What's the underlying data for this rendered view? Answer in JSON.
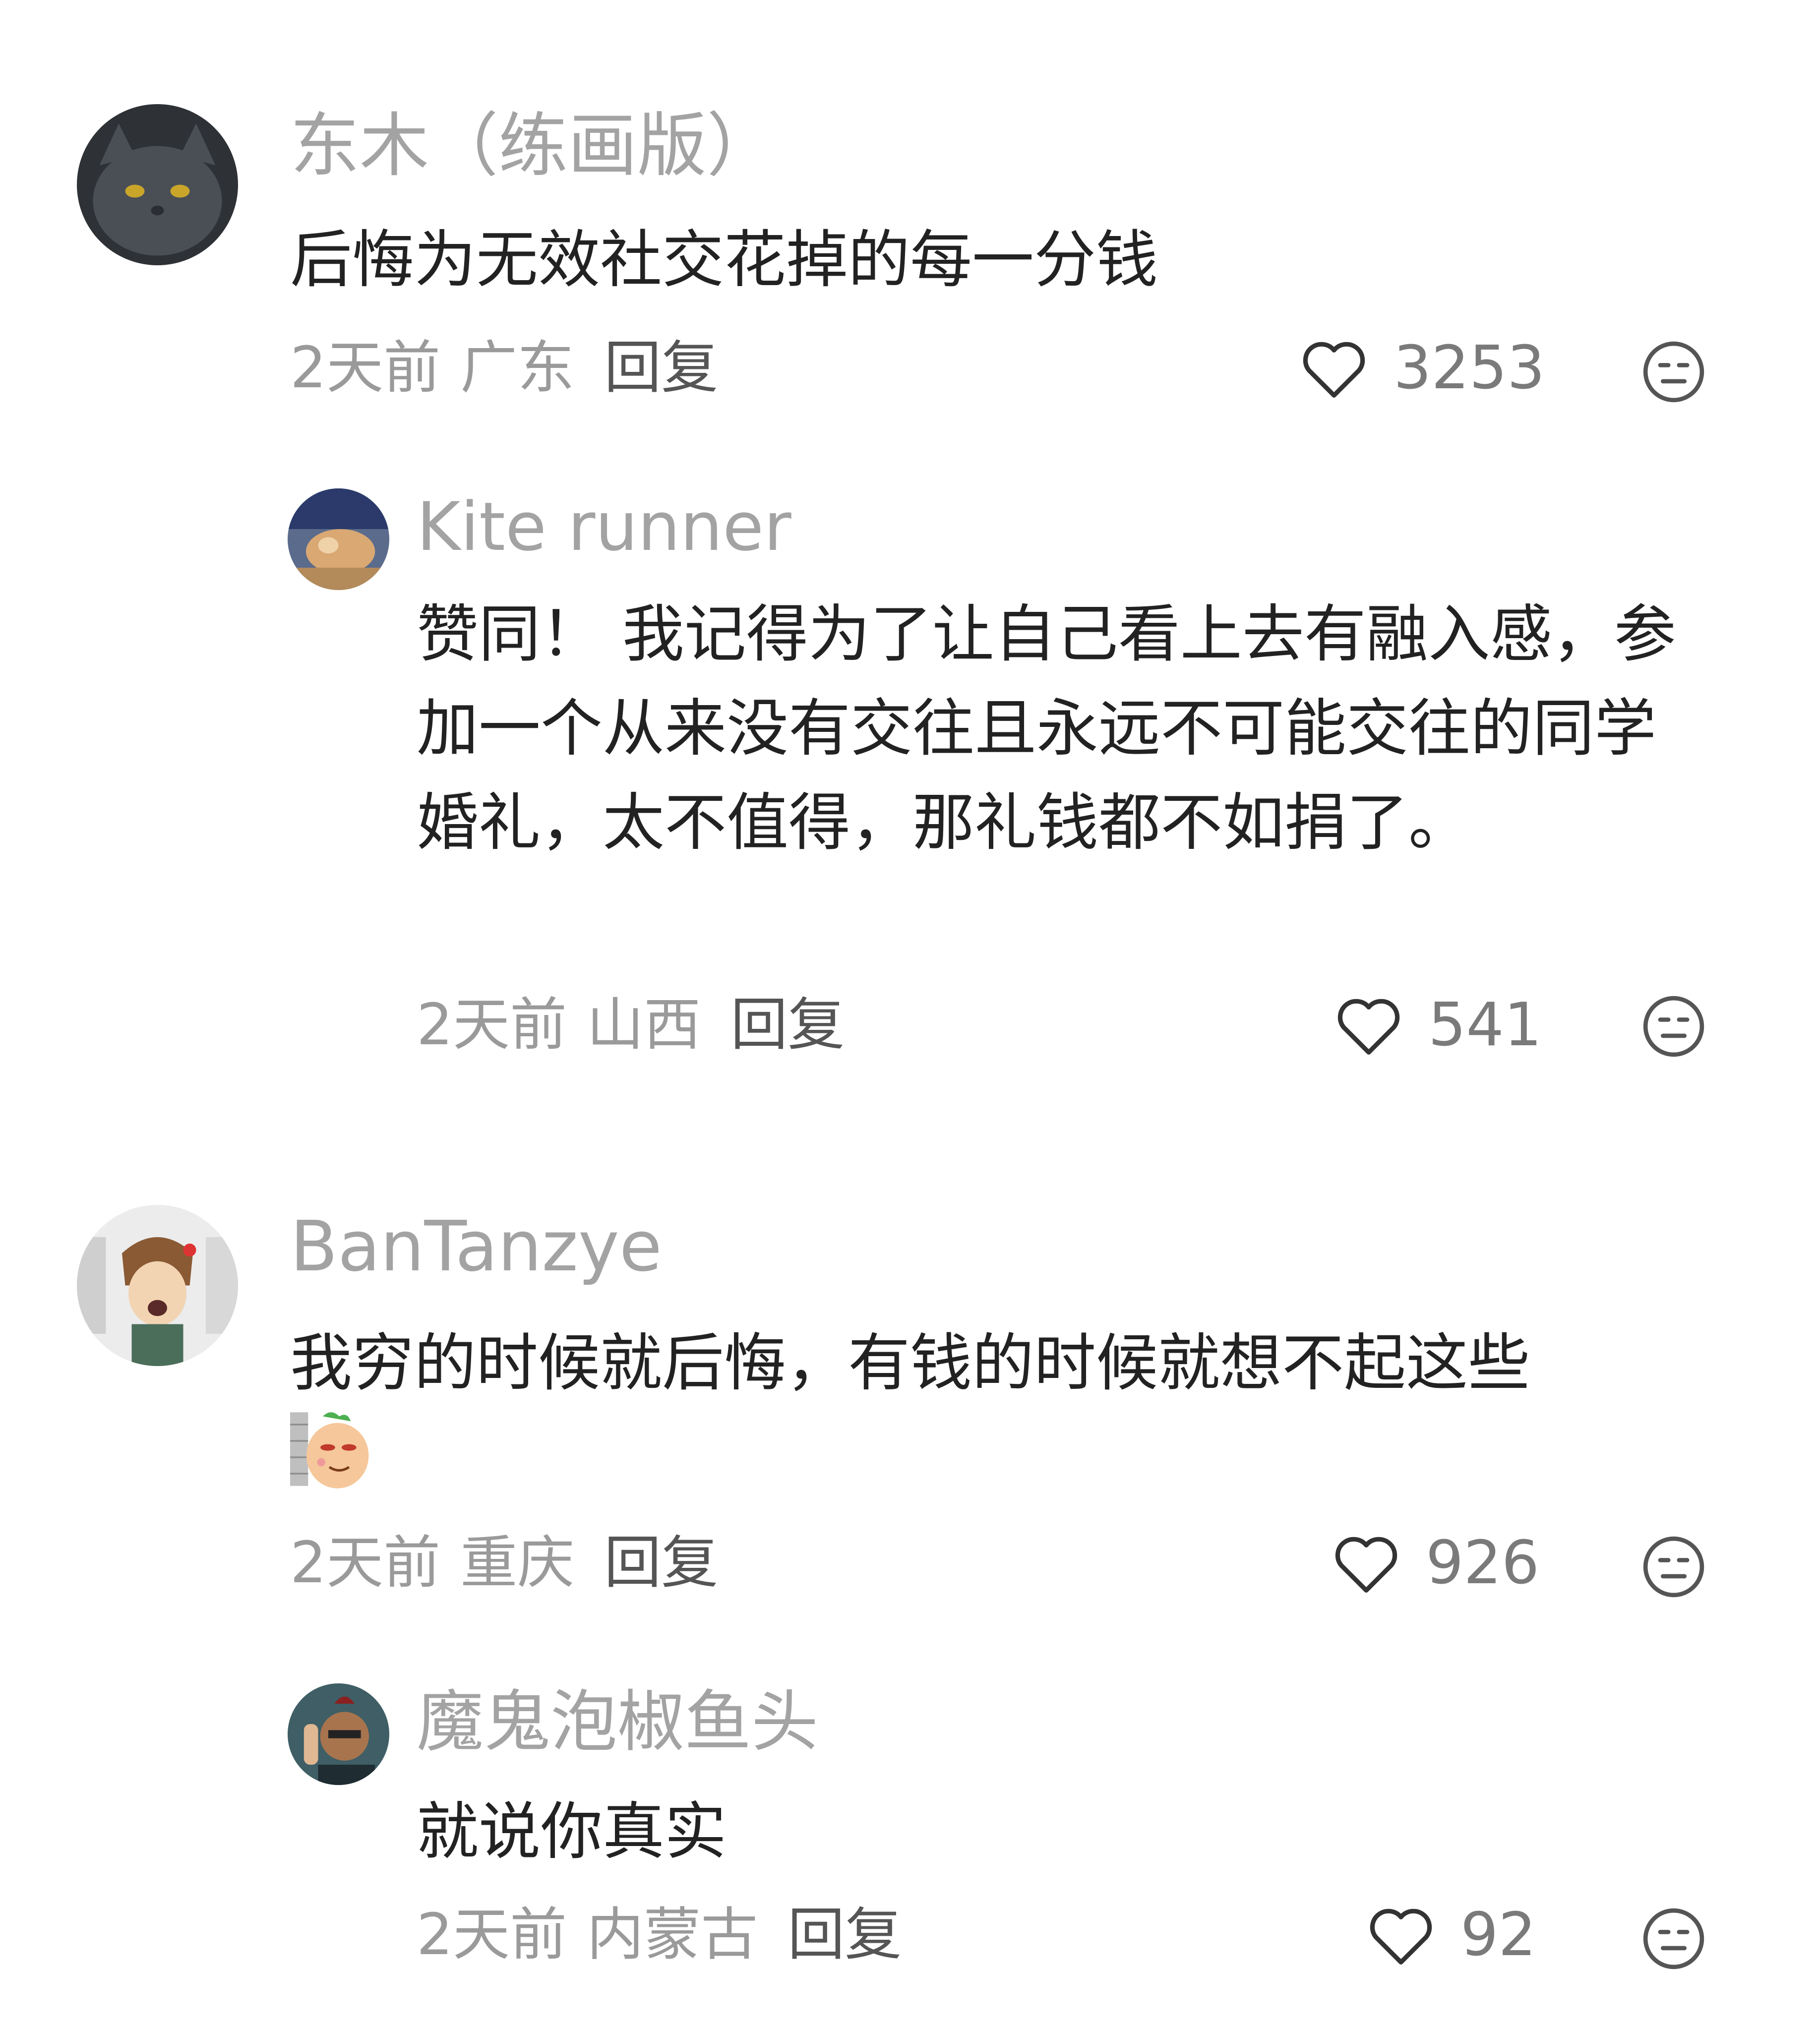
{
  "comments": [
    {
      "username": "东木（练画版）",
      "text": "后悔为无效社交花掉的每一分钱",
      "time": "2天前",
      "location": "广东",
      "reply_label": "回复",
      "likes": "3253"
    },
    {
      "username": "Kite runner",
      "text": "赞同！ 我记得为了让自己看上去有融入感，参加一个从来没有交往且永远不可能交往的同学婚礼，太不值得，那礼钱都不如捐了。",
      "time": "2天前",
      "location": "山西",
      "reply_label": "回复",
      "likes": "541"
    },
    {
      "username": "BanTanzye",
      "text": "我穷的时候就后悔，有钱的时候就想不起这些",
      "time": "2天前",
      "location": "重庆",
      "reply_label": "回复",
      "likes": "926"
    },
    {
      "username": "魔鬼泡椒鱼头",
      "text": "就说你真实",
      "time": "2天前",
      "location": "内蒙古",
      "reply_label": "回复",
      "likes": "92"
    }
  ],
  "icons": {
    "like": "heart-outline-icon",
    "emoji": "neutral-face-icon"
  }
}
